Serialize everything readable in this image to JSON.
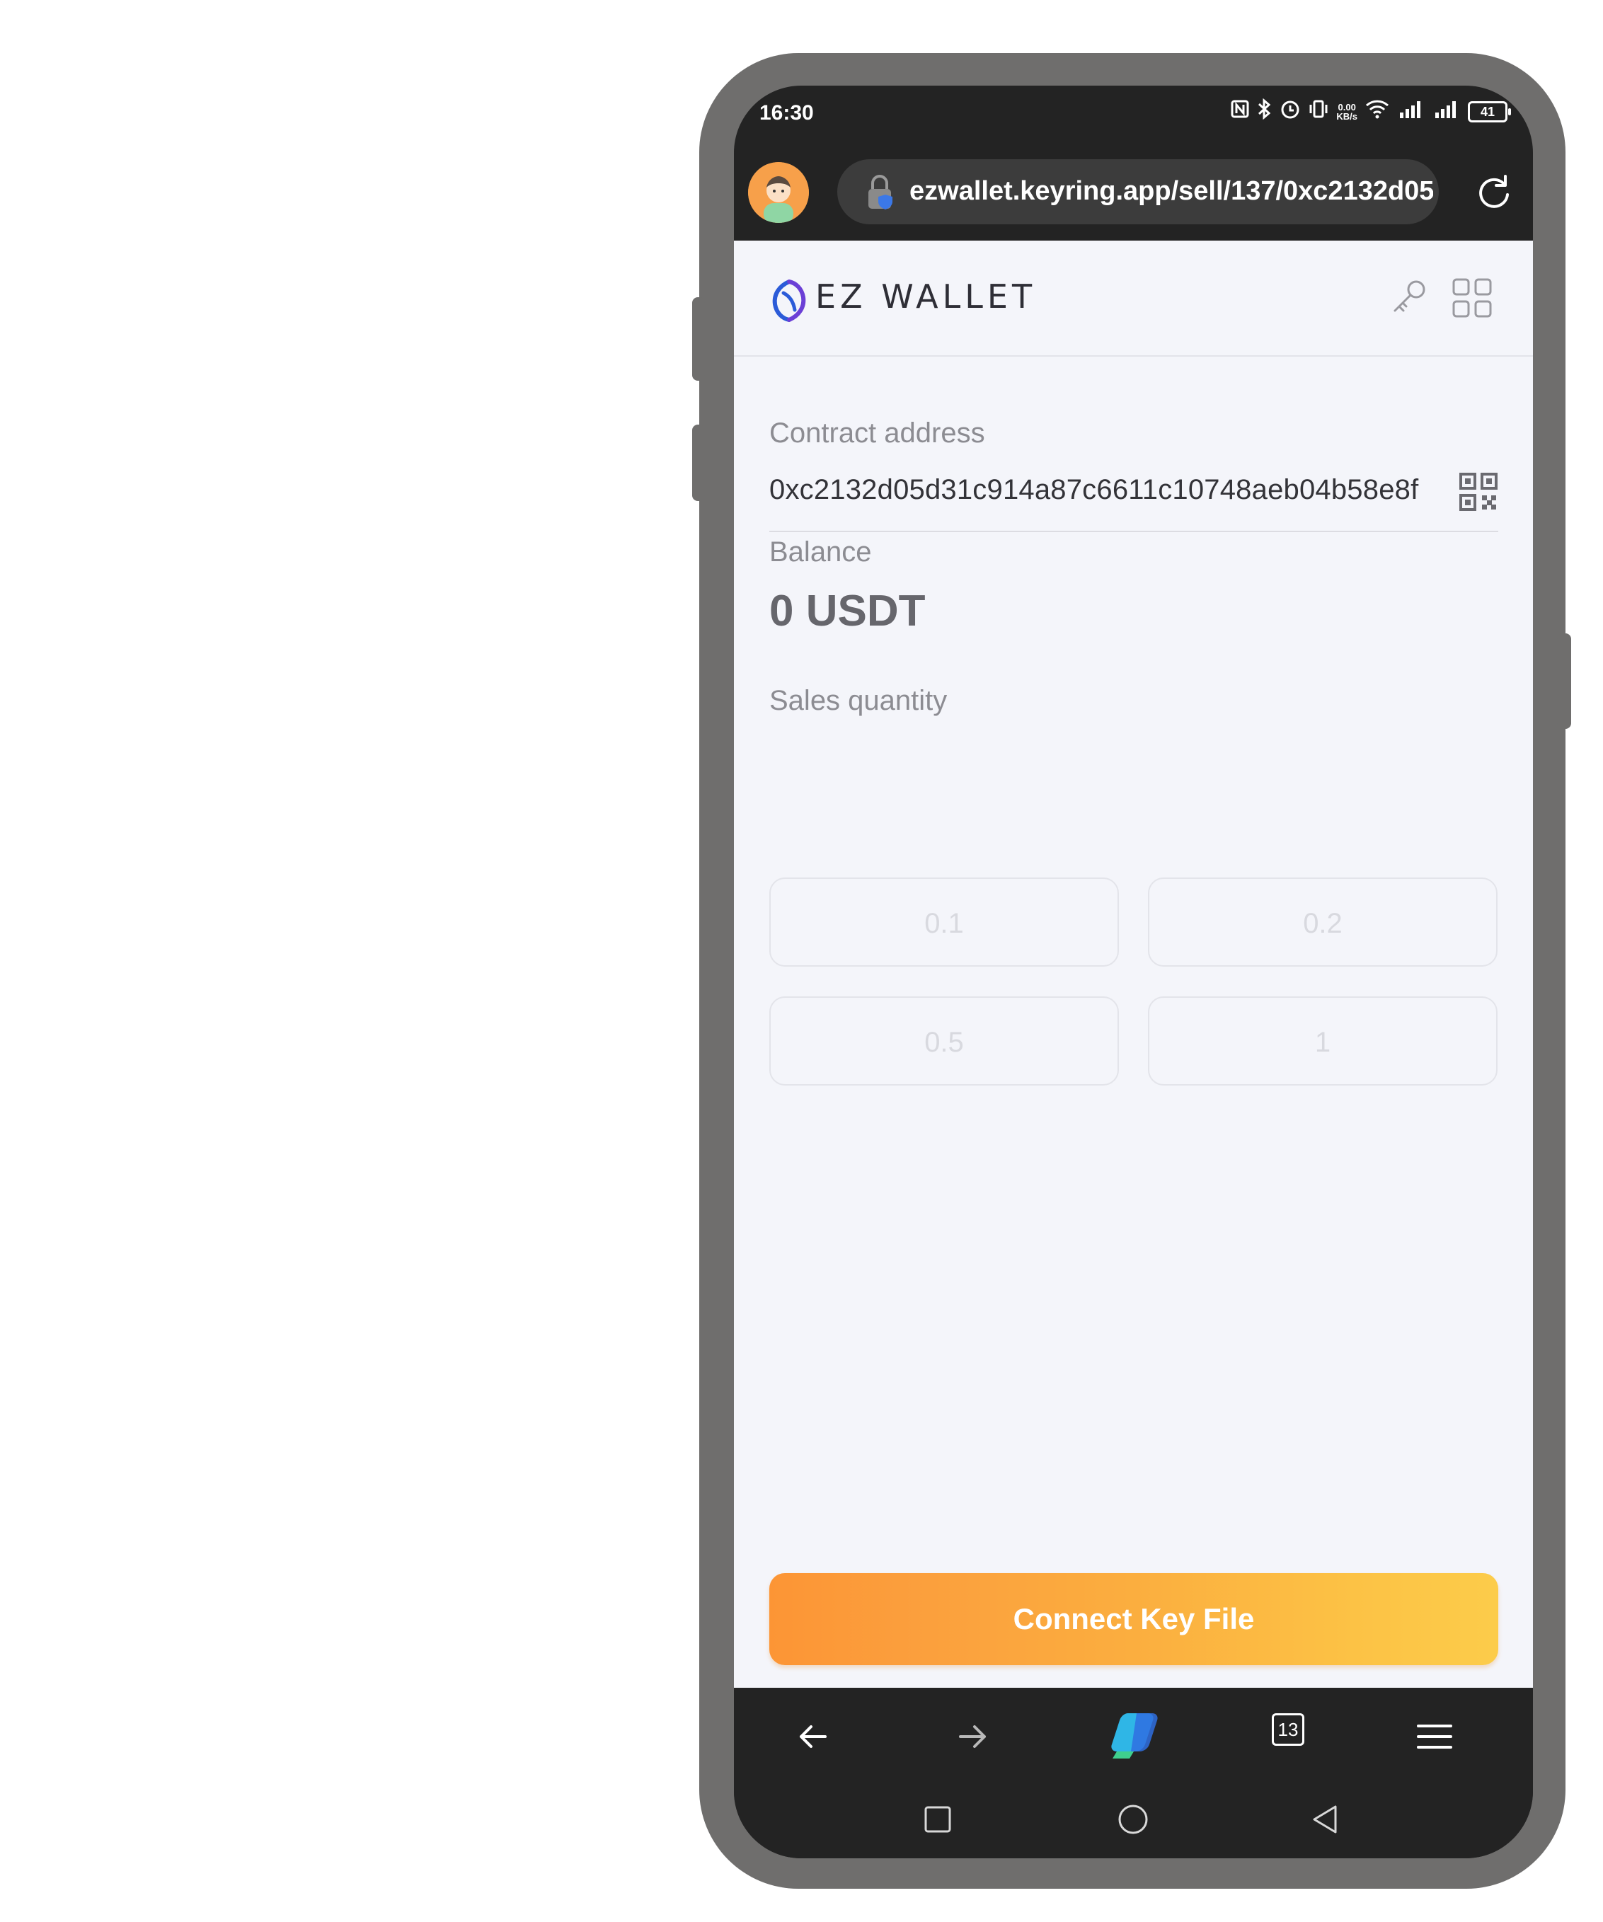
{
  "status_bar": {
    "time": "16:30",
    "net_speed_value": "0.00",
    "net_speed_unit": "KB/s",
    "battery_level": "41",
    "icons": [
      "nfc-icon",
      "bluetooth-icon",
      "alarm-icon",
      "vibrate-icon",
      "wifi-icon",
      "signal-icon",
      "signal-icon",
      "battery-icon"
    ]
  },
  "browser": {
    "url": "ezwallet.keyring.app/sell/137/0xc2132d05d31c914a87c6611c10748aeb04b58e8f",
    "tab_count": "13",
    "icons": {
      "avatar": "profile-avatar",
      "lock": "lock-icon",
      "reload": "reload-icon",
      "back": "back-arrow-icon",
      "forward": "forward-arrow-icon",
      "copilot": "copilot-icon",
      "menu": "hamburger-menu-icon"
    }
  },
  "app": {
    "brand": "EZ WALLET",
    "icons": {
      "logo": "wallet-logo",
      "key": "key-icon",
      "apps": "grid-icon",
      "qr": "qr-code-icon"
    },
    "contract_label": "Contract address",
    "contract_address": "0xc2132d05d31c914a87c6611c10748aeb04b58e8f",
    "balance_label": "Balance",
    "balance_value": "0 USDT",
    "sales_label": "Sales quantity",
    "sales_options": [
      "0.1",
      "0.2",
      "0.5",
      "1"
    ],
    "connect_button": "Connect Key File"
  },
  "colors": {
    "accent_start": "#fc9535",
    "accent_end": "#fccc4a",
    "logo_blue": "#2b5bd8"
  }
}
